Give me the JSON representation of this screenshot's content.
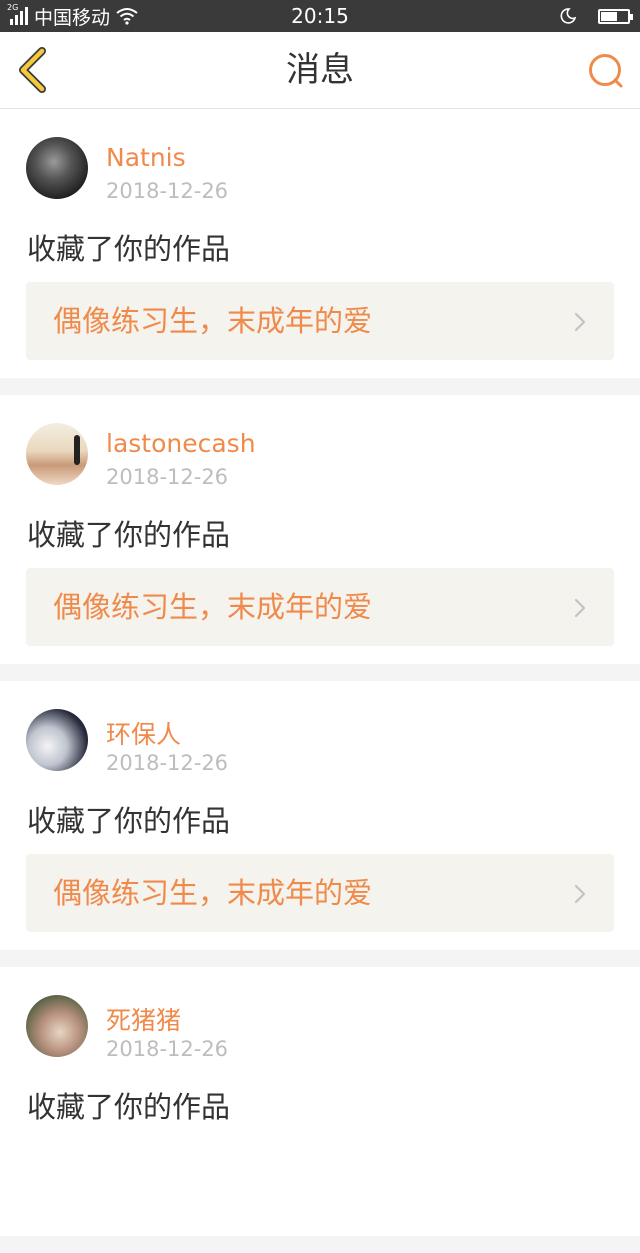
{
  "status_bar": {
    "signal_tag": "2G",
    "carrier": "中国移动",
    "time": "20:15",
    "battery_level": 0.6
  },
  "header": {
    "title": "消息"
  },
  "messages": [
    {
      "username": "Natnis",
      "date": "2018-12-26",
      "action": "收藏了你的作品",
      "work_title": "偶像练习生，末成年的爱"
    },
    {
      "username": "lastonecash",
      "date": "2018-12-26",
      "action": "收藏了你的作品",
      "work_title": "偶像练习生，末成年的爱"
    },
    {
      "username": "环保人",
      "date": "2018-12-26",
      "action": "收藏了你的作品",
      "work_title": "偶像练习生，末成年的爱"
    },
    {
      "username": "死猪猪",
      "date": "2018-12-26",
      "action": "收藏了你的作品",
      "work_title": ""
    }
  ],
  "icons": {
    "back": "chevron-left-icon",
    "search": "search-icon",
    "item_arrow": "chevron-right-icon"
  },
  "colors": {
    "accent": "#f08a4b",
    "back_icon": "#f5c93b",
    "status_bar": "#3a3a3a",
    "page_bg": "#f4f4f4",
    "link_bg": "#f4f3ee"
  }
}
